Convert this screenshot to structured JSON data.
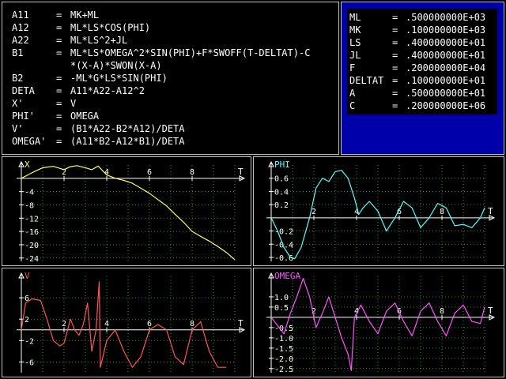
{
  "equations": [
    {
      "lhs": "A11",
      "eq": "=",
      "rhs": "MK+ML"
    },
    {
      "lhs": "A12",
      "eq": "=",
      "rhs": "ML*LS*COS(PHI)"
    },
    {
      "lhs": "A22",
      "eq": "=",
      "rhs": "ML*LS^2+JL"
    },
    {
      "lhs": "B1",
      "eq": "=",
      "rhs": "ML*LS*OMEGA^2*SIN(PHI)+F*SWOFF(T-DELTAT)-C"
    },
    {
      "lhs": "",
      "eq": "",
      "rhs": "*(X-A)*SWON(X-A)"
    },
    {
      "lhs": "B2",
      "eq": "=",
      "rhs": "-ML*G*LS*SIN(PHI)"
    },
    {
      "lhs": "DETA",
      "eq": "=",
      "rhs": "A11*A22-A12^2"
    },
    {
      "lhs": "X'",
      "eq": "=",
      "rhs": "V"
    },
    {
      "lhs": "PHI'",
      "eq": "=",
      "rhs": "OMEGA"
    },
    {
      "lhs": "V'",
      "eq": "=",
      "rhs": "(B1*A22-B2*A12)/DETA"
    },
    {
      "lhs": "OMEGA'",
      "eq": "=",
      "rhs": "(A11*B2-A12*B1)/DETA"
    }
  ],
  "parameters": [
    {
      "name": "ML",
      "eq": "=",
      "value": ".500000000E+03"
    },
    {
      "name": "MK",
      "eq": "=",
      "value": ".100000000E+03"
    },
    {
      "name": "LS",
      "eq": "=",
      "value": ".400000000E+01"
    },
    {
      "name": "JL",
      "eq": "=",
      "value": ".400000000E+01"
    },
    {
      "name": "F",
      "eq": "=",
      "value": ".200000000E+04"
    },
    {
      "name": "DELTAT",
      "eq": "=",
      "value": ".100000000E+01"
    },
    {
      "name": "A",
      "eq": "=",
      "value": ".500000000E+01"
    },
    {
      "name": "C",
      "eq": "=",
      "value": ".200000000E+06"
    }
  ],
  "chart_data": [
    {
      "type": "line",
      "ylabel": "X",
      "xlabel": "T",
      "xlim": [
        0,
        10
      ],
      "ylim": [
        -25,
        4
      ],
      "xticks": [
        "2",
        "4",
        "6",
        "8"
      ],
      "xtick_values": [
        2,
        4,
        6,
        8
      ],
      "yticks": [
        "-4",
        "-8",
        "-12",
        "-16",
        "-20",
        "-24"
      ],
      "ytick_values": [
        -4,
        -8,
        -12,
        -16,
        -20,
        -24
      ],
      "color": "#ffff55",
      "series": [
        {
          "x": [
            0,
            0.3,
            0.6,
            1.0,
            1.5,
            2.0,
            2.3,
            2.6,
            3.0,
            3.3,
            3.6,
            4.0,
            4.4,
            4.8,
            5.2,
            5.6,
            6.0,
            6.4,
            6.8,
            7.2,
            7.6,
            8.0,
            8.4,
            8.8,
            9.2,
            9.6,
            10.0
          ],
          "y": [
            0,
            1.0,
            2.0,
            3.2,
            3.6,
            2.6,
            3.5,
            3.8,
            3.2,
            2.6,
            3.7,
            1.0,
            0.0,
            -0.6,
            -1.5,
            -3.0,
            -4.5,
            -6.4,
            -8.3,
            -10.8,
            -13.2,
            -16.0,
            -17.5,
            -18.9,
            -20.5,
            -22.3,
            -24.5
          ]
        }
      ]
    },
    {
      "type": "line",
      "ylabel": "PHI",
      "xlabel": "T",
      "xlim": [
        0,
        10
      ],
      "ylim": [
        -0.66,
        0.8
      ],
      "xticks": [
        "2",
        "4",
        "6",
        "8"
      ],
      "xtick_values": [
        2,
        4,
        6,
        8
      ],
      "yticks": [
        "0.6",
        "0.4",
        "0.2",
        "-0.2",
        "-0.4",
        "-0.6"
      ],
      "ytick_values": [
        0.6,
        0.4,
        0.2,
        -0.2,
        -0.4,
        -0.6
      ],
      "color": "#55ffff",
      "series": [
        {
          "x": [
            0,
            0.3,
            0.6,
            0.9,
            1.1,
            1.4,
            1.8,
            2.1,
            2.4,
            2.7,
            3.0,
            3.3,
            3.6,
            3.9,
            4.1,
            4.3,
            4.6,
            5.0,
            5.4,
            5.8,
            6.2,
            6.6,
            7.0,
            7.4,
            7.8,
            8.2,
            8.6,
            9.0,
            9.4,
            9.8,
            10.0
          ],
          "y": [
            0,
            -0.2,
            -0.45,
            -0.6,
            -0.62,
            -0.45,
            0.0,
            0.45,
            0.6,
            0.55,
            0.7,
            0.72,
            0.6,
            0.3,
            0.05,
            0.15,
            0.25,
            0.1,
            -0.2,
            0.0,
            0.25,
            0.15,
            -0.15,
            0.0,
            0.22,
            0.15,
            -0.12,
            -0.1,
            -0.15,
            0.0,
            0.15
          ]
        }
      ]
    },
    {
      "type": "line",
      "ylabel": "V",
      "xlabel": "T",
      "xlim": [
        0,
        10
      ],
      "ylim": [
        -8,
        10
      ],
      "xticks": [
        "2",
        "4",
        "6",
        "8"
      ],
      "xtick_values": [
        2,
        4,
        6,
        8
      ],
      "yticks": [
        "6",
        "2",
        "-2",
        "-6"
      ],
      "ytick_values": [
        6,
        2,
        -2,
        -6
      ],
      "color": "#ff5555",
      "series": [
        {
          "x": [
            0,
            0.2,
            0.5,
            0.9,
            1.2,
            1.5,
            1.8,
            2.0,
            2.3,
            2.5,
            2.7,
            2.9,
            3.1,
            3.3,
            3.5,
            3.65,
            3.7,
            4.0,
            4.4,
            4.8,
            5.2,
            5.6,
            6.0,
            6.4,
            6.8,
            7.2,
            7.6,
            8.0,
            8.4,
            8.8,
            9.2,
            9.6
          ],
          "y": [
            0,
            5.0,
            5.8,
            5.5,
            2.0,
            -2.0,
            -3.0,
            -2.5,
            2.0,
            0.0,
            -1.0,
            1.0,
            5.0,
            -4.0,
            0.0,
            9.0,
            -7.0,
            -2.0,
            0.0,
            -4.0,
            -7.0,
            -5.0,
            0.0,
            1.0,
            0.0,
            -5.0,
            -6.5,
            0.0,
            1.5,
            -4.0,
            -7.0,
            -7.0
          ]
        }
      ]
    },
    {
      "type": "line",
      "ylabel": "OMEGA",
      "xlabel": "T",
      "xlim": [
        0,
        10
      ],
      "ylim": [
        -2.7,
        2.0
      ],
      "xticks": [
        "2",
        "4",
        "6",
        "8"
      ],
      "xtick_values": [
        2,
        4,
        6,
        8
      ],
      "yticks": [
        "1.0",
        "0.5",
        "-0.5",
        "-1.0",
        "-1.5",
        "-2.0",
        "-2.5"
      ],
      "ytick_values": [
        1.0,
        0.5,
        -0.5,
        -1.0,
        -1.5,
        -2.0,
        -2.5
      ],
      "color": "#ff55ff",
      "series": [
        {
          "x": [
            0,
            0.3,
            0.6,
            0.9,
            1.2,
            1.5,
            1.8,
            2.1,
            2.4,
            2.7,
            3.0,
            3.3,
            3.6,
            3.75,
            3.9,
            4.2,
            4.6,
            5.0,
            5.4,
            5.8,
            6.2,
            6.6,
            7.0,
            7.4,
            7.8,
            8.2,
            8.6,
            9.0,
            9.4,
            9.8,
            10.0
          ],
          "y": [
            0,
            -0.4,
            -0.8,
            0.2,
            1.0,
            1.9,
            1.0,
            -0.5,
            0.2,
            1.0,
            0.0,
            -1.0,
            -1.8,
            -2.6,
            0.0,
            0.6,
            -0.2,
            -0.8,
            0.3,
            0.7,
            -0.2,
            -0.9,
            0.3,
            0.7,
            -0.2,
            -0.9,
            0.2,
            0.6,
            -0.2,
            -0.3,
            0.5
          ]
        }
      ]
    }
  ]
}
